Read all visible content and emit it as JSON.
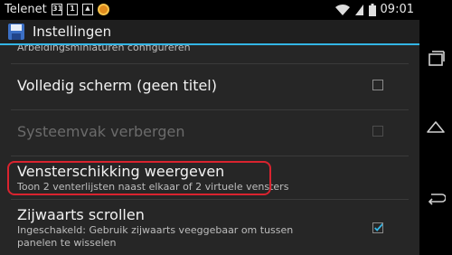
{
  "status_bar": {
    "carrier": "Telenet",
    "icons": [
      "calendar-icon",
      "calendar-icon",
      "image-icon",
      "app-notification-icon"
    ],
    "calendar_day": "31",
    "second_icon_text": "1",
    "time": "09:01"
  },
  "action_bar": {
    "title": "Instellingen",
    "accent_color": "#33b5e5"
  },
  "settings": {
    "items": [
      {
        "title": "Arbeidingsminiaturen configureren",
        "summary": "",
        "checked": null,
        "enabled": true
      },
      {
        "title": "Volledig scherm (geen titel)",
        "summary": "",
        "checked": false,
        "enabled": true
      },
      {
        "title": "Systeemvak verbergen",
        "summary": "",
        "checked": false,
        "enabled": false
      },
      {
        "title": "Vensterschikking weergeven",
        "summary": "Toon 2 venterlijsten naast elkaar of 2 virtuele vensters",
        "checked": null,
        "enabled": true
      },
      {
        "title": "Zijwaarts scrollen",
        "summary": "Ingeschakeld: Gebruik zijwaarts veeggebaar om tussen panelen te wisselen",
        "checked": true,
        "enabled": true
      }
    ]
  },
  "highlight_color": "#d9232f",
  "navigation": [
    "recent-apps-icon",
    "home-icon",
    "back-icon"
  ]
}
